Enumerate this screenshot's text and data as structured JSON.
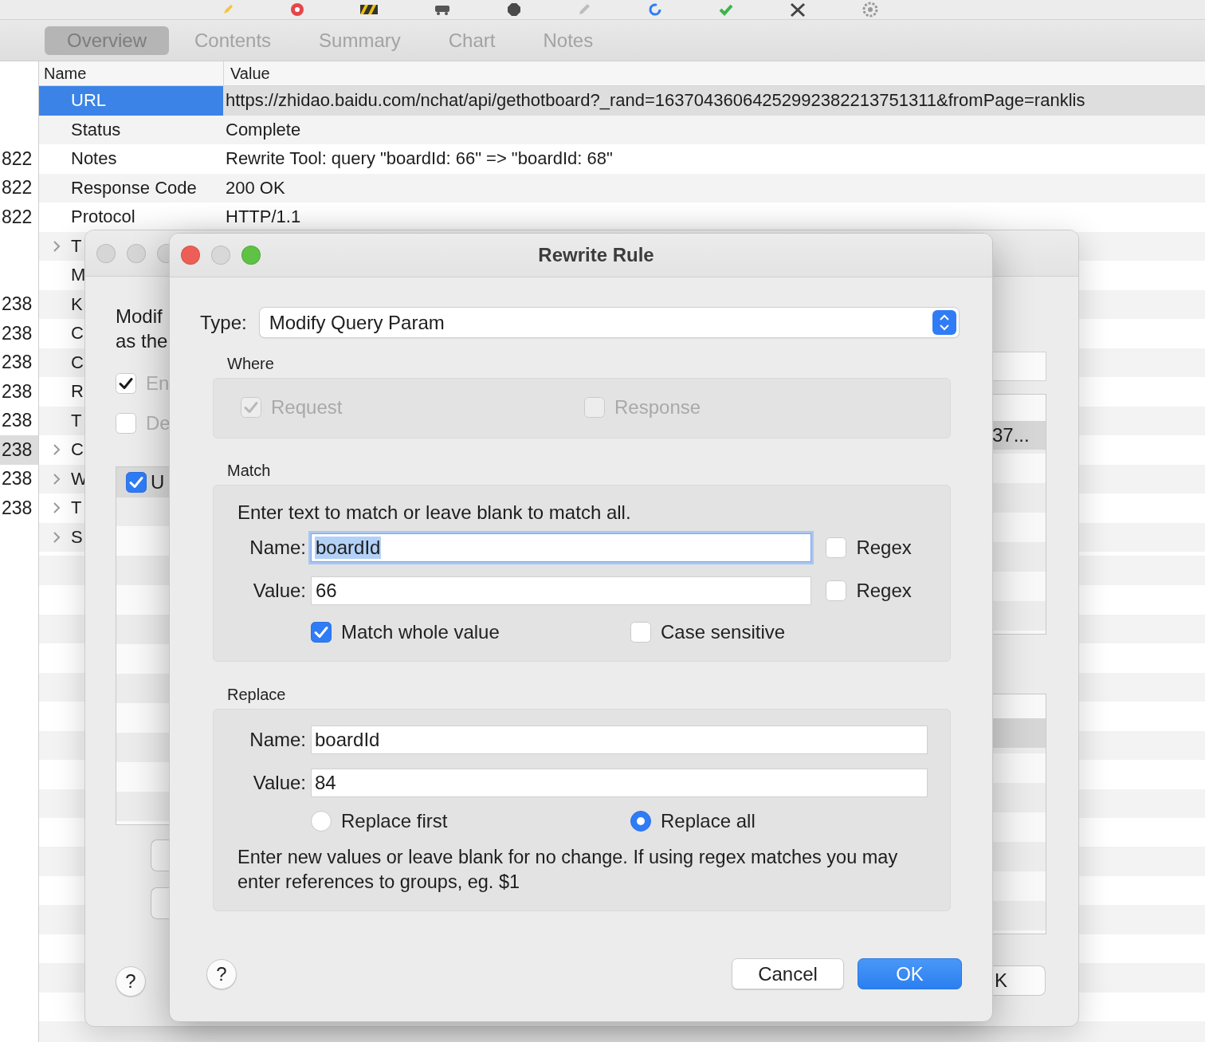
{
  "tabs": [
    {
      "label": "Overview",
      "selected": true
    },
    {
      "label": "Contents",
      "selected": false
    },
    {
      "label": "Summary",
      "selected": false
    },
    {
      "label": "Chart",
      "selected": false
    },
    {
      "label": "Notes",
      "selected": false
    }
  ],
  "table": {
    "columns": [
      "Name",
      "Value"
    ],
    "rows": [
      {
        "name": "URL",
        "value": "https://zhidao.baidu.com/nchat/api/gethotboard?_rand=16370436064252992382213751311&fromPage=ranklis",
        "expandable": false,
        "selected": true
      },
      {
        "name": "Status",
        "value": "Complete",
        "expandable": false,
        "selected": false
      },
      {
        "name": "Notes",
        "value": "Rewrite Tool: query \"boardId: 66\" => \"boardId: 68\"",
        "expandable": false,
        "selected": false,
        "session": {
          "text": "822",
          "selected": false
        }
      },
      {
        "name": "Response Code",
        "value": "200 OK",
        "expandable": false,
        "selected": false,
        "session": {
          "text": "822",
          "selected": false
        }
      },
      {
        "name": "Protocol",
        "value": "HTTP/1.1",
        "expandable": false,
        "selected": false,
        "session": {
          "text": "822",
          "selected": false
        }
      },
      {
        "name": "T",
        "expandable": true,
        "selected": false
      },
      {
        "name": "M",
        "expandable": false,
        "selected": false
      },
      {
        "name": "K",
        "expandable": false,
        "selected": false,
        "session": {
          "text": "238",
          "selected": false
        }
      },
      {
        "name": "C",
        "expandable": false,
        "selected": false,
        "session": {
          "text": "238",
          "selected": false
        }
      },
      {
        "name": "C",
        "expandable": false,
        "selected": false,
        "session": {
          "text": "238",
          "selected": false
        }
      },
      {
        "name": "R",
        "expandable": false,
        "selected": false,
        "session": {
          "text": "238",
          "selected": false
        }
      },
      {
        "name": "T",
        "expandable": false,
        "selected": false,
        "session": {
          "text": "238",
          "selected": false
        }
      },
      {
        "name": "C",
        "expandable": true,
        "selected": false,
        "session": {
          "text": "238",
          "selected": true
        }
      },
      {
        "name": "W",
        "expandable": true,
        "selected": false,
        "session": {
          "text": "238",
          "selected": false
        }
      },
      {
        "name": "T",
        "expandable": true,
        "selected": false,
        "session": {
          "text": "238",
          "selected": false
        }
      },
      {
        "name": "S",
        "expandable": true,
        "selected": false
      }
    ]
  },
  "background_dialog": {
    "description": [
      "Modif",
      "as the"
    ],
    "options": [
      {
        "label": "En",
        "checked": true
      },
      {
        "label": "De",
        "checked": false
      }
    ],
    "list_items": [
      {
        "label": "U",
        "checked": true,
        "selected": true
      }
    ],
    "right_table_rows": [
      {
        "text": "37...",
        "selected": true
      }
    ],
    "ok_button": "K",
    "help_button": "?"
  },
  "dialog": {
    "title": "Rewrite Rule",
    "type": {
      "label": "Type:",
      "value": "Modify Query Param"
    },
    "where": {
      "title": "Where",
      "options": [
        {
          "label": "Request",
          "checked": true,
          "disabled": true
        },
        {
          "label": "Response",
          "checked": false,
          "disabled": true
        }
      ]
    },
    "match": {
      "title": "Match",
      "hint": "Enter text to match or leave blank to match all.",
      "fields": [
        {
          "label": "Name:",
          "value": "boardId",
          "focused": true,
          "regex": {
            "label": "Regex",
            "checked": false
          }
        },
        {
          "label": "Value:",
          "value": "66",
          "focused": false,
          "regex": {
            "label": "Regex",
            "checked": false
          }
        }
      ],
      "options": [
        {
          "label": "Match whole value",
          "checked": true
        },
        {
          "label": "Case sensitive",
          "checked": false
        }
      ]
    },
    "replace": {
      "title": "Replace",
      "fields": [
        {
          "label": "Name:",
          "value": "boardId"
        },
        {
          "label": "Value:",
          "value": "84"
        }
      ],
      "modes": [
        {
          "label": "Replace first",
          "selected": false
        },
        {
          "label": "Replace all",
          "selected": true
        }
      ],
      "note": "Enter new values or leave blank for no change. If using regex matches you may enter references to groups, eg. $1"
    },
    "help_button": "?",
    "buttons": [
      {
        "label": "Cancel",
        "kind": "secondary"
      },
      {
        "label": "OK",
        "kind": "primary"
      }
    ]
  }
}
